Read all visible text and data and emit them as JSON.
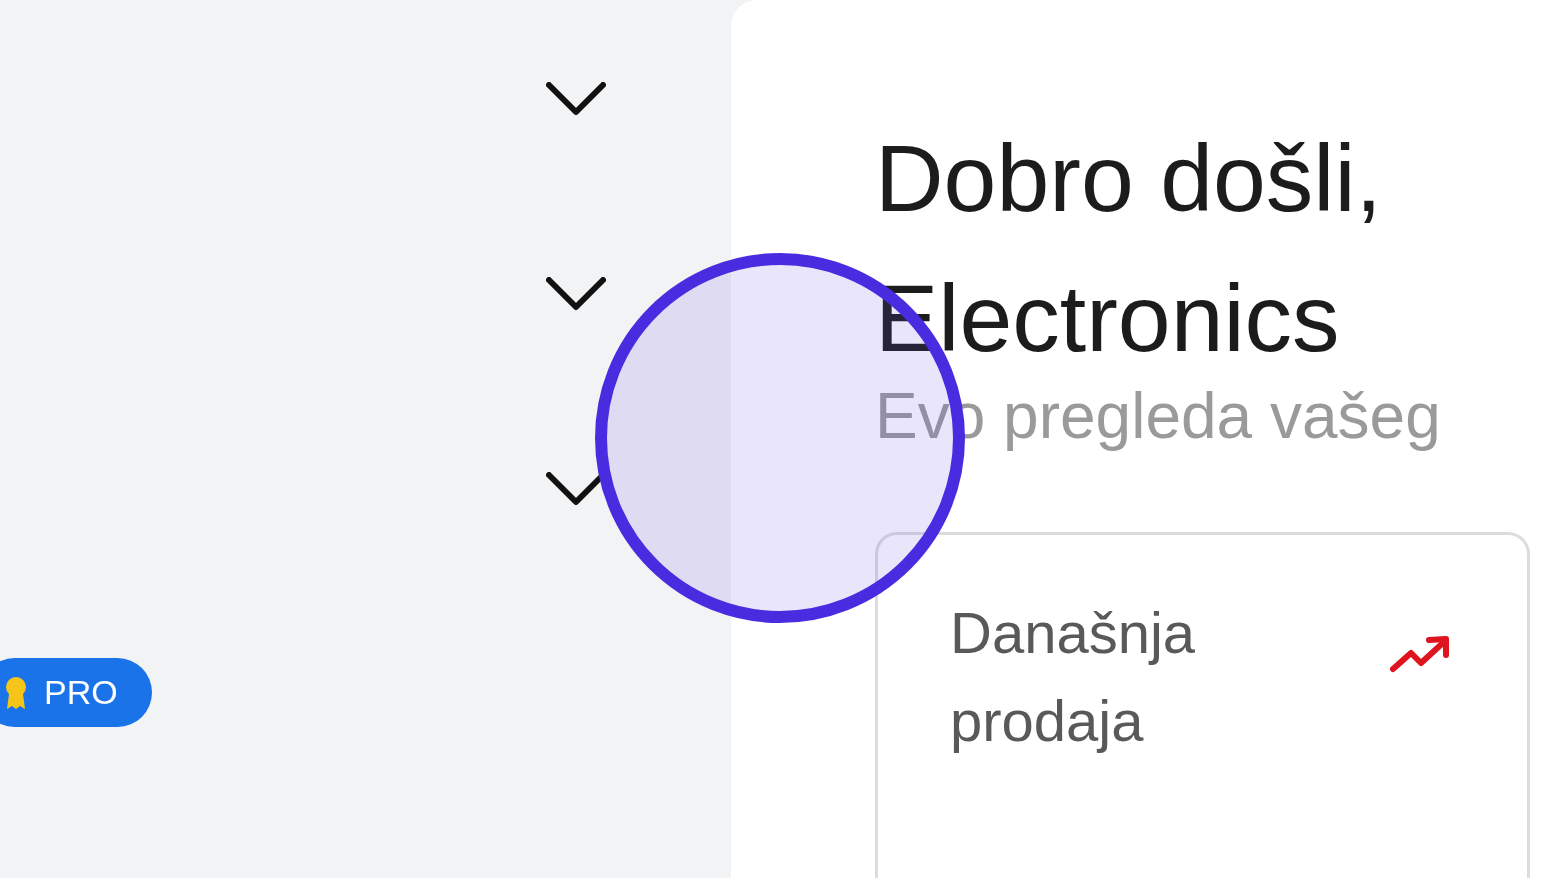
{
  "sidebar": {
    "sections": [
      {
        "expanded": false
      },
      {
        "expanded": false
      },
      {
        "expanded": false
      }
    ],
    "badge": {
      "label": "PRO"
    }
  },
  "main": {
    "heading_lines": [
      "Dobro došli,",
      "Electronics"
    ],
    "subtitle": "Evo pregleda vašeg",
    "stat_card": {
      "label": "Današnja prodaja"
    }
  }
}
